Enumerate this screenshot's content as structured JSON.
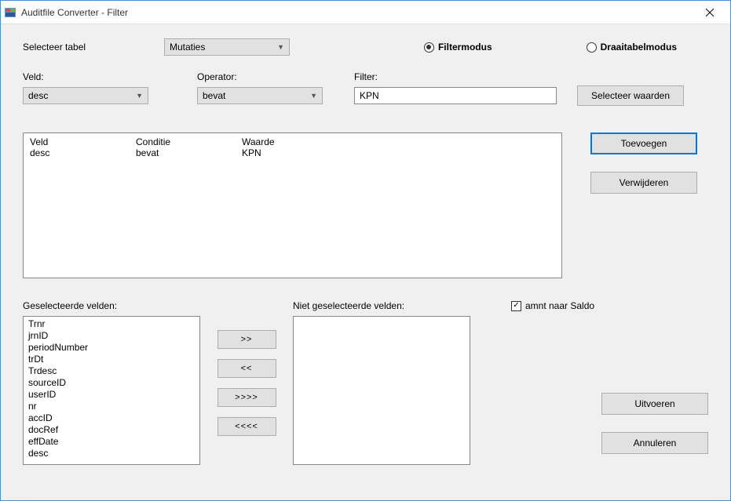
{
  "window": {
    "title": "Auditfile Converter - Filter"
  },
  "top": {
    "select_table_label": "Selecteer tabel",
    "table_value": "Mutaties",
    "mode": {
      "filter_label": "Filtermodus",
      "pivot_label": "Draaitabelmodus",
      "selected": "filter"
    }
  },
  "filter": {
    "field_label": "Veld:",
    "field_value": "desc",
    "operator_label": "Operator:",
    "operator_value": "bevat",
    "filter_label": "Filter:",
    "filter_value": "KPN",
    "select_values_button": "Selecteer waarden"
  },
  "conditions": {
    "headers": {
      "veld": "Veld",
      "conditie": "Conditie",
      "waarde": "Waarde"
    },
    "rows": [
      {
        "veld": "desc",
        "conditie": "bevat",
        "waarde": "KPN"
      }
    ]
  },
  "side_buttons": {
    "add": "Toevoegen",
    "remove": "Verwijderen"
  },
  "fields": {
    "selected_label": "Geselecteerde velden:",
    "unselected_label": "Niet geselecteerde velden:",
    "selected": [
      "Trnr",
      "jrnID",
      "periodNumber",
      "trDt",
      "Trdesc",
      "sourceID",
      "userID",
      "nr",
      "accID",
      "docRef",
      "effDate",
      "desc"
    ],
    "unselected": []
  },
  "move": {
    "right": ">>",
    "left": "<<",
    "all_right": ">>>>",
    "all_left": "<<<<"
  },
  "options": {
    "amnt_saldo_label": "amnt naar Saldo",
    "amnt_saldo_checked": true
  },
  "actions": {
    "execute": "Uitvoeren",
    "cancel": "Annuleren"
  }
}
